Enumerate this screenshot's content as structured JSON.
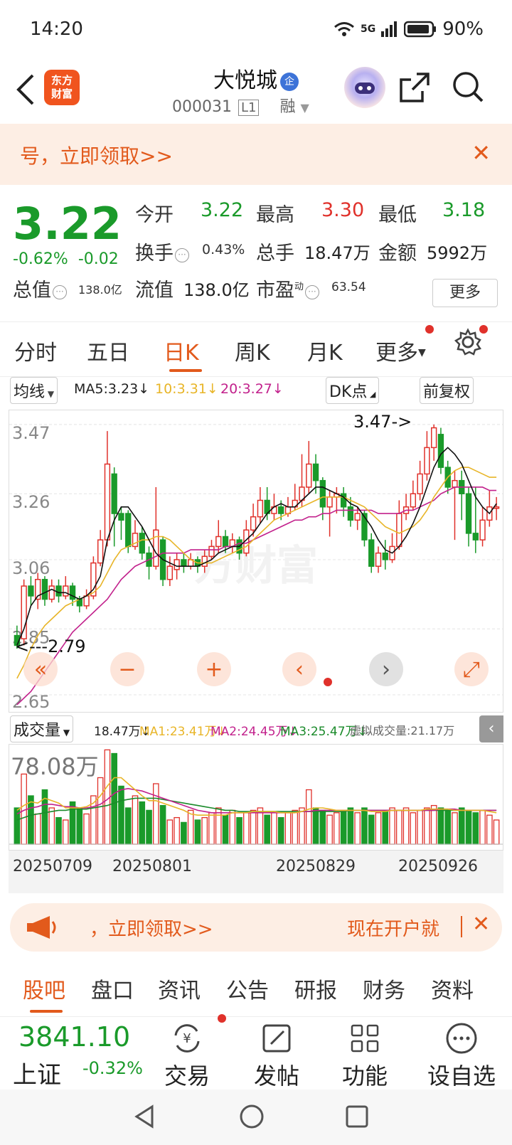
{
  "status": {
    "time": "14:20",
    "network": "5G",
    "battery": "90%"
  },
  "header": {
    "logo_line1": "东方",
    "logo_line2": "财富",
    "title": "大悦城",
    "title_badge": "企",
    "code": "000031",
    "level": "L1",
    "margin": "融"
  },
  "promo": {
    "text": "号，立即领取>>"
  },
  "quote": {
    "price": "3.22",
    "change_pct": "-0.62%",
    "change": "-0.02",
    "open_label": "今开",
    "open": "3.22",
    "high_label": "最高",
    "high": "3.30",
    "low_label": "最低",
    "low": "3.18",
    "turnover_label": "换手",
    "turnover": "0.43%",
    "volume_label": "总手",
    "volume": "18.47万",
    "amount_label": "金额",
    "amount": "5992万",
    "mktcap_label": "总值",
    "mktcap": "138.0亿",
    "float_label": "流值",
    "float": "138.0亿",
    "pe_label": "市盈",
    "pe_sup": "动",
    "pe": "63.54",
    "more": "更多"
  },
  "tabs": [
    "分时",
    "五日",
    "日K",
    "周K",
    "月K",
    "更多"
  ],
  "ma_row": {
    "selector": "均线",
    "ma5": "MA5:3.23",
    "ma10": "10:3.31",
    "ma20": "20:3.27",
    "dk": "DK点",
    "adjust": "前复权"
  },
  "chart_data": {
    "type": "candlestick",
    "y_ticks": [
      "3.47",
      "3.26",
      "3.06",
      "2.85",
      "2.65"
    ],
    "ylim": [
      2.65,
      3.5
    ],
    "max_label": "3.47->",
    "min_label": "<---2.79",
    "x_labels": [
      "20250709",
      "20250801",
      "20250829",
      "20250926"
    ],
    "watermark": "方财富",
    "candles": [
      [
        2.83,
        2.8,
        2.86,
        2.79
      ],
      [
        2.82,
        2.98,
        3.0,
        2.8
      ],
      [
        2.98,
        2.95,
        3.01,
        2.92
      ],
      [
        2.94,
        3.0,
        3.02,
        2.91
      ],
      [
        3.0,
        2.94,
        3.01,
        2.92
      ],
      [
        2.94,
        2.98,
        3.0,
        2.93
      ],
      [
        2.98,
        2.95,
        3.0,
        2.93
      ],
      [
        2.95,
        2.98,
        3.01,
        2.94
      ],
      [
        2.98,
        2.94,
        2.99,
        2.92
      ],
      [
        2.94,
        2.92,
        2.95,
        2.9
      ],
      [
        2.92,
        2.95,
        2.97,
        2.91
      ],
      [
        2.95,
        3.05,
        3.07,
        2.94
      ],
      [
        3.05,
        3.12,
        3.15,
        3.04
      ],
      [
        3.12,
        3.35,
        3.45,
        3.1
      ],
      [
        3.32,
        3.2,
        3.34,
        3.1
      ],
      [
        3.2,
        3.18,
        3.22,
        3.12
      ],
      [
        3.2,
        3.1,
        3.21,
        3.08
      ],
      [
        3.1,
        3.14,
        3.18,
        3.09
      ],
      [
        3.14,
        3.08,
        3.16,
        3.06
      ],
      [
        3.08,
        3.04,
        3.1,
        3.0
      ],
      [
        3.04,
        3.15,
        3.28,
        3.03
      ],
      [
        3.12,
        3.0,
        3.13,
        2.98
      ],
      [
        3.0,
        3.04,
        3.07,
        2.98
      ],
      [
        3.03,
        3.06,
        3.08,
        3.0
      ],
      [
        3.06,
        3.04,
        3.08,
        3.02
      ],
      [
        3.04,
        3.06,
        3.08,
        3.03
      ],
      [
        3.06,
        3.04,
        3.07,
        3.02
      ],
      [
        3.04,
        3.07,
        3.09,
        3.02
      ],
      [
        3.07,
        3.1,
        3.12,
        3.06
      ],
      [
        3.1,
        3.13,
        3.18,
        3.08
      ],
      [
        3.13,
        3.1,
        3.15,
        3.08
      ],
      [
        3.1,
        3.12,
        3.14,
        3.08
      ],
      [
        3.12,
        3.08,
        3.13,
        3.06
      ],
      [
        3.08,
        3.15,
        3.18,
        3.07
      ],
      [
        3.15,
        3.19,
        3.23,
        3.13
      ],
      [
        3.19,
        3.24,
        3.28,
        3.17
      ],
      [
        3.24,
        3.2,
        3.28,
        3.18
      ],
      [
        3.2,
        3.22,
        3.26,
        3.18
      ],
      [
        3.22,
        3.2,
        3.24,
        3.18
      ],
      [
        3.2,
        3.22,
        3.25,
        3.19
      ],
      [
        3.22,
        3.24,
        3.29,
        3.21
      ],
      [
        3.24,
        3.28,
        3.38,
        3.22
      ],
      [
        3.28,
        3.35,
        3.42,
        3.26
      ],
      [
        3.35,
        3.3,
        3.38,
        3.26
      ],
      [
        3.3,
        3.22,
        3.31,
        3.18
      ],
      [
        3.22,
        3.25,
        3.27,
        3.13
      ],
      [
        3.25,
        3.26,
        3.28,
        3.2
      ],
      [
        3.26,
        3.22,
        3.28,
        3.19
      ],
      [
        3.22,
        3.18,
        3.25,
        3.16
      ],
      [
        3.18,
        3.2,
        3.22,
        3.15
      ],
      [
        3.2,
        3.12,
        3.21,
        3.1
      ],
      [
        3.12,
        3.04,
        3.14,
        3.02
      ],
      [
        3.04,
        3.08,
        3.1,
        3.02
      ],
      [
        3.08,
        3.06,
        3.12,
        3.03
      ],
      [
        3.06,
        3.1,
        3.14,
        3.05
      ],
      [
        3.1,
        3.2,
        3.24,
        3.09
      ],
      [
        3.2,
        3.22,
        3.26,
        3.18
      ],
      [
        3.22,
        3.26,
        3.3,
        3.21
      ],
      [
        3.26,
        3.32,
        3.36,
        3.24
      ],
      [
        3.32,
        3.4,
        3.45,
        3.3
      ],
      [
        3.4,
        3.46,
        3.47,
        3.36
      ],
      [
        3.44,
        3.34,
        3.46,
        3.32
      ],
      [
        3.34,
        3.28,
        3.36,
        3.26
      ],
      [
        3.28,
        3.3,
        3.33,
        3.12
      ],
      [
        3.3,
        3.26,
        3.33,
        3.18
      ],
      [
        3.26,
        3.14,
        3.28,
        3.1
      ],
      [
        3.14,
        3.12,
        3.28,
        3.08
      ],
      [
        3.12,
        3.18,
        3.22,
        3.1
      ],
      [
        3.18,
        3.22,
        3.27,
        3.16
      ],
      [
        3.22,
        3.22,
        3.25,
        3.18
      ]
    ],
    "ma5": [
      2.8,
      2.85,
      2.92,
      2.95,
      2.96,
      2.97,
      2.96,
      2.96,
      2.95,
      2.94,
      2.95,
      2.97,
      3.01,
      3.12,
      3.18,
      3.22,
      3.22,
      3.19,
      3.16,
      3.12,
      3.08,
      3.06,
      3.05,
      3.04,
      3.04,
      3.04,
      3.04,
      3.05,
      3.06,
      3.08,
      3.09,
      3.1,
      3.1,
      3.12,
      3.14,
      3.17,
      3.2,
      3.22,
      3.23,
      3.22,
      3.22,
      3.24,
      3.26,
      3.28,
      3.28,
      3.27,
      3.26,
      3.25,
      3.23,
      3.22,
      3.19,
      3.16,
      3.12,
      3.09,
      3.08,
      3.1,
      3.13,
      3.17,
      3.22,
      3.28,
      3.34,
      3.38,
      3.4,
      3.38,
      3.35,
      3.3,
      3.25,
      3.22,
      3.2,
      3.23
    ],
    "ma10": [
      2.7,
      2.74,
      2.79,
      2.83,
      2.86,
      2.88,
      2.9,
      2.92,
      2.93,
      2.94,
      2.95,
      2.96,
      2.98,
      3.02,
      3.06,
      3.09,
      3.1,
      3.11,
      3.12,
      3.12,
      3.13,
      3.13,
      3.12,
      3.1,
      3.08,
      3.06,
      3.05,
      3.05,
      3.05,
      3.06,
      3.07,
      3.08,
      3.09,
      3.1,
      3.12,
      3.14,
      3.16,
      3.18,
      3.19,
      3.2,
      3.21,
      3.22,
      3.23,
      3.24,
      3.25,
      3.25,
      3.25,
      3.25,
      3.24,
      3.23,
      3.22,
      3.2,
      3.18,
      3.16,
      3.15,
      3.14,
      3.15,
      3.16,
      3.18,
      3.21,
      3.25,
      3.28,
      3.31,
      3.33,
      3.34,
      3.34,
      3.33,
      3.32,
      3.31,
      3.31
    ],
    "ma20": [
      2.62,
      2.64,
      2.66,
      2.69,
      2.72,
      2.75,
      2.78,
      2.81,
      2.84,
      2.86,
      2.88,
      2.9,
      2.92,
      2.94,
      2.97,
      3.0,
      3.02,
      3.04,
      3.05,
      3.06,
      3.07,
      3.08,
      3.08,
      3.08,
      3.08,
      3.09,
      3.09,
      3.09,
      3.09,
      3.09,
      3.1,
      3.1,
      3.11,
      3.11,
      3.12,
      3.13,
      3.14,
      3.15,
      3.16,
      3.17,
      3.18,
      3.18,
      3.19,
      3.19,
      3.2,
      3.2,
      3.21,
      3.21,
      3.21,
      3.21,
      3.21,
      3.21,
      3.2,
      3.2,
      3.2,
      3.2,
      3.21,
      3.21,
      3.22,
      3.23,
      3.24,
      3.26,
      3.27,
      3.28,
      3.28,
      3.28,
      3.28,
      3.28,
      3.27,
      3.27
    ]
  },
  "vol_row": {
    "selector": "成交量",
    "vol": "18.47万",
    "ma1": "MA1:23.41万",
    "ma2": "MA2:24.45万",
    "ma3": "MA3:25.47万",
    "virtual": "虚拟成交量:21.17万"
  },
  "vol_data": {
    "max_label": "78.08万",
    "ymax": 80,
    "values": [
      30,
      58,
      40,
      25,
      45,
      30,
      22,
      20,
      35,
      30,
      25,
      40,
      55,
      78,
      75,
      48,
      30,
      40,
      35,
      28,
      50,
      32,
      20,
      22,
      18,
      28,
      20,
      22,
      26,
      30,
      24,
      28,
      22,
      26,
      28,
      30,
      24,
      26,
      22,
      26,
      28,
      30,
      45,
      30,
      28,
      24,
      26,
      28,
      30,
      26,
      30,
      24,
      26,
      28,
      30,
      28,
      30,
      26,
      28,
      30,
      32,
      30,
      28,
      26,
      30,
      28,
      26,
      28,
      24,
      20
    ],
    "ma1": [
      28,
      32,
      35,
      34,
      38,
      36,
      34,
      30,
      30,
      30,
      31,
      34,
      40,
      48,
      55,
      55,
      50,
      45,
      40,
      36,
      36,
      34,
      32,
      30,
      28,
      25,
      24,
      24,
      24,
      24,
      24,
      26,
      26,
      26,
      27,
      27,
      27,
      27,
      26,
      26,
      26,
      27,
      29,
      30,
      30,
      29,
      28,
      28,
      28,
      28,
      28,
      27,
      27,
      27,
      28,
      28,
      28,
      28,
      28,
      29,
      29,
      29,
      29,
      28,
      28,
      28,
      28,
      28,
      27,
      26
    ],
    "ma2": [
      25,
      28,
      30,
      31,
      33,
      33,
      32,
      31,
      31,
      30,
      30,
      31,
      33,
      37,
      42,
      45,
      46,
      45,
      44,
      42,
      40,
      38,
      36,
      34,
      32,
      30,
      28,
      27,
      26,
      26,
      26,
      26,
      26,
      26,
      26,
      26,
      26,
      26,
      26,
      26,
      26,
      27,
      27,
      28,
      28,
      28,
      28,
      28,
      28,
      28,
      28,
      28,
      28,
      28,
      28,
      28,
      28,
      28,
      28,
      28,
      28,
      29,
      29,
      29,
      28,
      28,
      28,
      28,
      28,
      28
    ],
    "ma3": [
      20,
      22,
      24,
      25,
      26,
      27,
      28,
      28,
      29,
      29,
      29,
      30,
      31,
      32,
      34,
      36,
      37,
      38,
      38,
      38,
      38,
      37,
      36,
      35,
      34,
      33,
      32,
      31,
      30,
      29,
      28,
      28,
      27,
      27,
      27,
      27,
      27,
      27,
      27,
      27,
      27,
      27,
      27,
      27,
      27,
      27,
      27,
      27,
      28,
      28,
      28,
      28,
      28,
      28,
      28,
      28,
      28,
      28,
      28,
      28,
      28,
      28,
      28,
      28,
      28,
      28,
      28,
      28,
      28,
      28
    ]
  },
  "promo2": {
    "left": "，立即领取>>",
    "right": "现在开户就"
  },
  "bottom_tabs": [
    "股吧",
    "盘口",
    "资讯",
    "公告",
    "研报",
    "财务",
    "资料"
  ],
  "index": {
    "value": "3841.10",
    "name": "上证",
    "change": "-0.32%"
  },
  "nav": [
    "交易",
    "发帖",
    "功能",
    "设自选"
  ],
  "colors": {
    "accent": "#e25a1c",
    "up": "#e0312b",
    "down": "#1a9a2a",
    "ma5": "#111111",
    "ma10": "#e8b528",
    "ma20": "#c2218c"
  }
}
